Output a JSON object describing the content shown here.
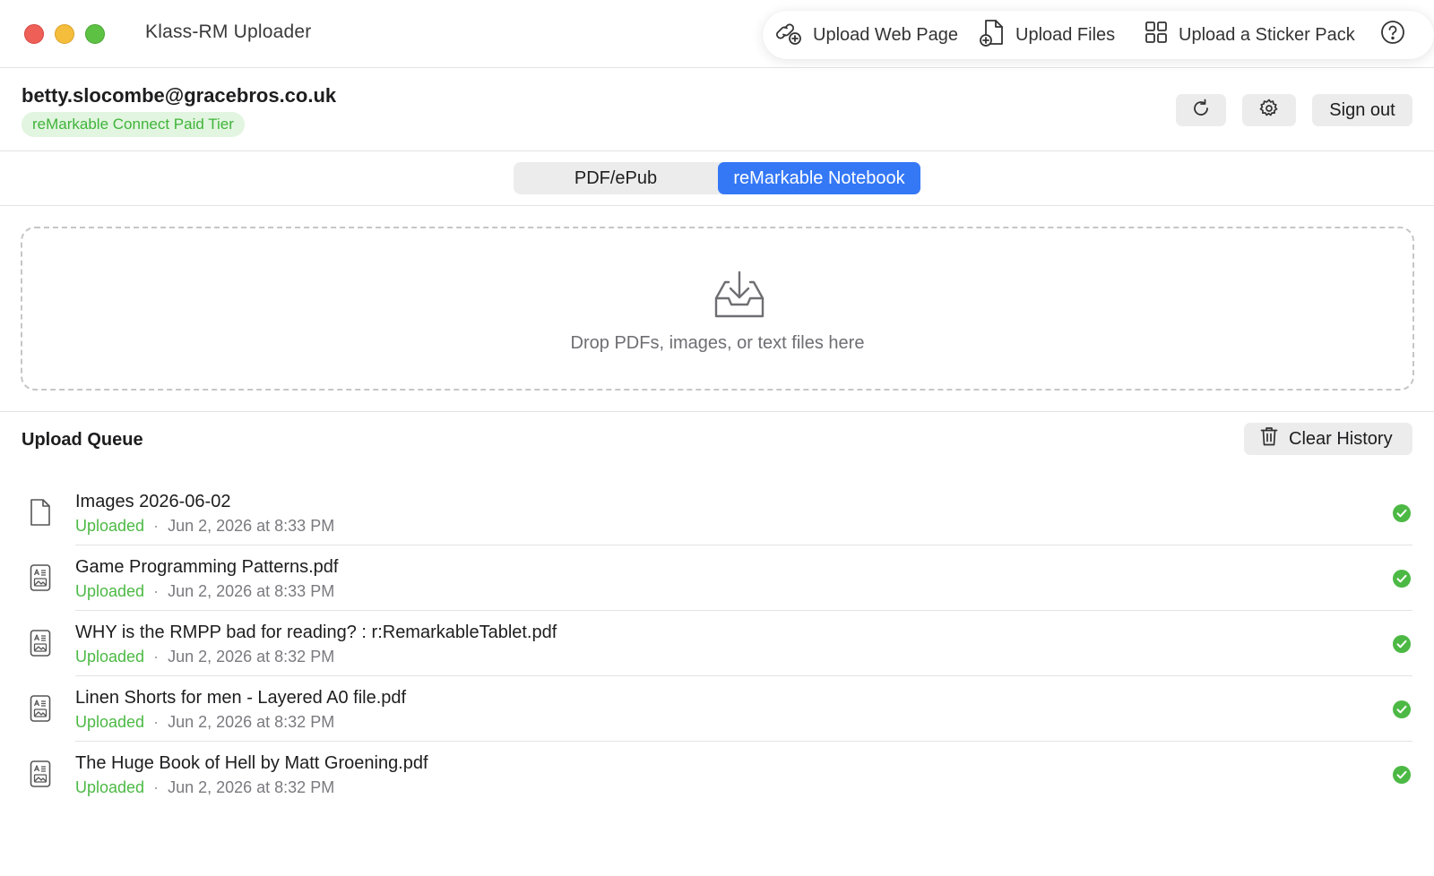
{
  "window": {
    "title": "Klass-RM Uploader"
  },
  "toolbar": {
    "upload_web_page": "Upload Web Page",
    "upload_files": "Upload Files",
    "upload_sticker_pack": "Upload a Sticker Pack"
  },
  "account": {
    "email": "betty.slocombe@gracebros.co.uk",
    "tier": "reMarkable Connect Paid Tier",
    "sign_out": "Sign out"
  },
  "segments": {
    "pdf_epub": "PDF/ePub",
    "notebook": "reMarkable Notebook",
    "selected": "reMarkable Notebook"
  },
  "dropzone": {
    "text": "Drop PDFs, images, or text files here"
  },
  "queue": {
    "title": "Upload Queue",
    "clear_history": "Clear History",
    "items": [
      {
        "name": "Images 2026-06-02",
        "status": "Uploaded",
        "time": "Jun 2, 2026 at 8:33 PM",
        "icon": "document-icon"
      },
      {
        "name": "Game Programming Patterns.pdf",
        "status": "Uploaded",
        "time": "Jun 2, 2026 at 8:33 PM",
        "icon": "pdf-document-icon"
      },
      {
        "name": "WHY is the RMPP bad for reading? : r:RemarkableTablet.pdf",
        "status": "Uploaded",
        "time": "Jun 2, 2026 at 8:32 PM",
        "icon": "pdf-document-icon"
      },
      {
        "name": "Linen Shorts for men - Layered A0 file.pdf",
        "status": "Uploaded",
        "time": "Jun 2, 2026 at 8:32 PM",
        "icon": "pdf-document-icon"
      },
      {
        "name": "The Huge Book of Hell by Matt Groening.pdf",
        "status": "Uploaded",
        "time": "Jun 2, 2026 at 8:32 PM",
        "icon": "pdf-document-icon"
      }
    ]
  },
  "colors": {
    "accent": "#3478f6",
    "success": "#4cb944",
    "badge_bg": "#e2f5e0"
  }
}
